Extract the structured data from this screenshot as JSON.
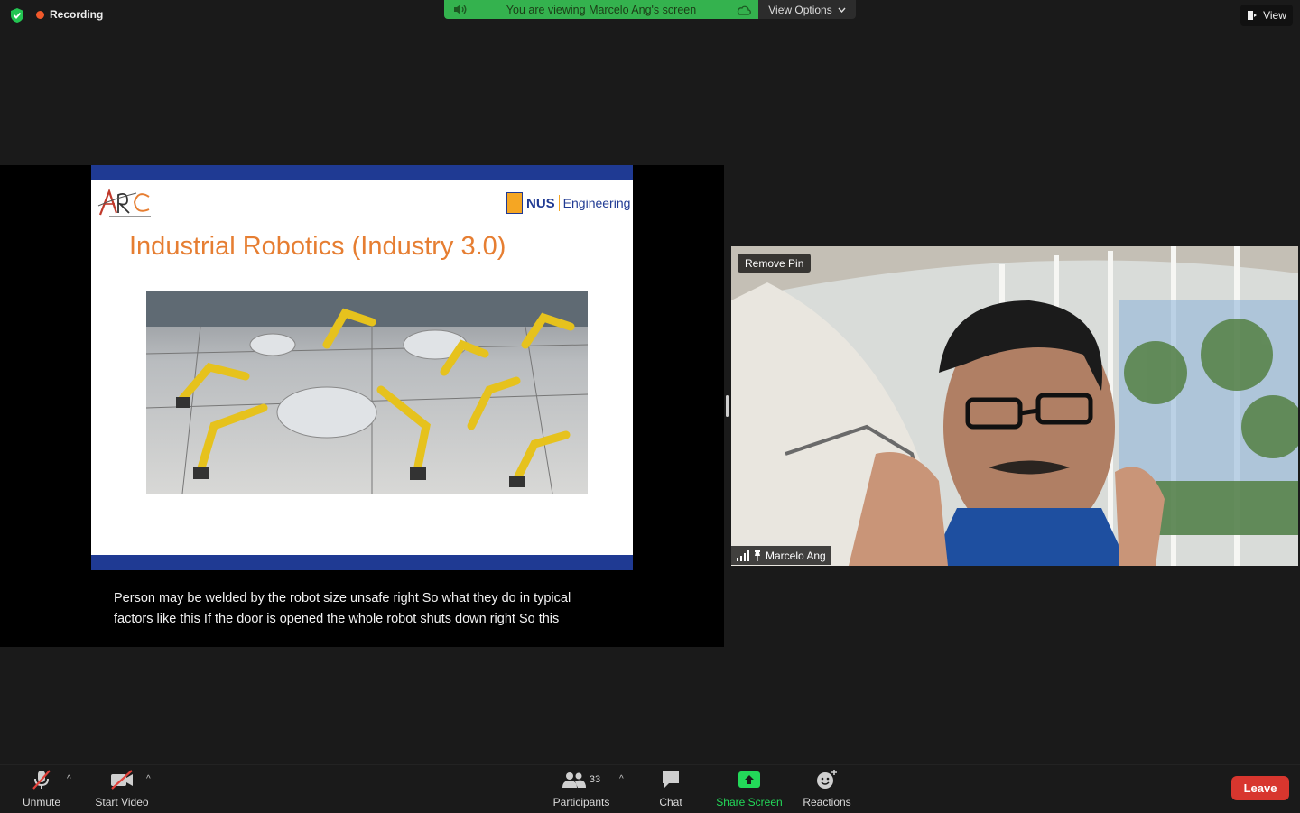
{
  "top_bar": {
    "recording_label": "Recording",
    "banner_text": "You are viewing Marcelo Ang's screen",
    "view_options_label": "View Options",
    "view_label": "View"
  },
  "shared_slide": {
    "title": "Industrial Robotics (Industry 3.0)",
    "logo_org": "NUS",
    "logo_dept": "Engineering"
  },
  "caption": {
    "line1": "Person may be welded by the robot size unsafe right So what they do in typical",
    "line2": "factors like this If the door is opened the whole robot shuts down right So this"
  },
  "video_tile": {
    "remove_pin_label": "Remove Pin",
    "participant_name": "Marcelo Ang"
  },
  "toolbar": {
    "unmute_label": "Unmute",
    "start_video_label": "Start Video",
    "participants_label": "Participants",
    "participants_count": "33",
    "chat_label": "Chat",
    "share_screen_label": "Share Screen",
    "reactions_label": "Reactions",
    "leave_label": "Leave"
  },
  "colors": {
    "banner_green": "#34b24e",
    "slide_bar_blue": "#1f3a93",
    "slide_title_orange": "#e67e32",
    "share_screen_green": "#23d959",
    "leave_red": "#d8362e",
    "recording_dot": "#f0592b"
  },
  "icons": [
    "shield-icon",
    "speaker-icon",
    "cloud-icon",
    "chevron-down-icon",
    "view-icon",
    "mic-muted-icon",
    "video-off-icon",
    "participants-icon",
    "chat-icon",
    "share-screen-icon",
    "reactions-icon",
    "signal-icon",
    "pin-icon"
  ]
}
